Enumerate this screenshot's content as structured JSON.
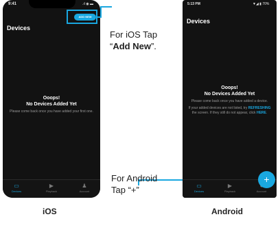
{
  "ios": {
    "time": "9:41",
    "signal": ".ıl ◉ ▬",
    "title": "Devices",
    "add_button": "ADD NEW",
    "empty_title_1": "Ooops!",
    "empty_title_2": "No Devices Added Yet",
    "empty_body": "Please come back once you have added your first one.",
    "tabs": [
      {
        "label": "Devices",
        "icon": "camera-icon"
      },
      {
        "label": "Playback",
        "icon": "play-icon"
      },
      {
        "label": "Account",
        "icon": "person-icon"
      }
    ],
    "caption": "iOS"
  },
  "android": {
    "time": "5:13 PM",
    "status": "▼◢ ▮ 70%",
    "title": "Devices",
    "empty_title_1": "Ooops!",
    "empty_title_2": "No Devices Added Yet",
    "empty_body_1": "Please come back once you have added a device.",
    "empty_body_2a": "If your added devices are not listed, try ",
    "refreshing": "REFRESHING",
    "empty_body_2b": " the screen. If they still do not appear, click ",
    "here": "HERE",
    "empty_body_2c": ".",
    "fab": "+",
    "tabs": [
      {
        "label": "Devices",
        "icon": "camera-icon"
      },
      {
        "label": "Playback",
        "icon": "play-icon"
      },
      {
        "label": "Account",
        "icon": "account-icon"
      }
    ],
    "caption": "Android"
  },
  "notes": {
    "ios_line1": "For iOS Tap",
    "ios_quote_open": "“",
    "ios_bold": "Add New",
    "ios_quote_close": "”.",
    "android_line1": "For Android",
    "android_line2": "Tap “+”"
  },
  "colors": {
    "accent": "#19a7e0",
    "screen": "#121212"
  }
}
